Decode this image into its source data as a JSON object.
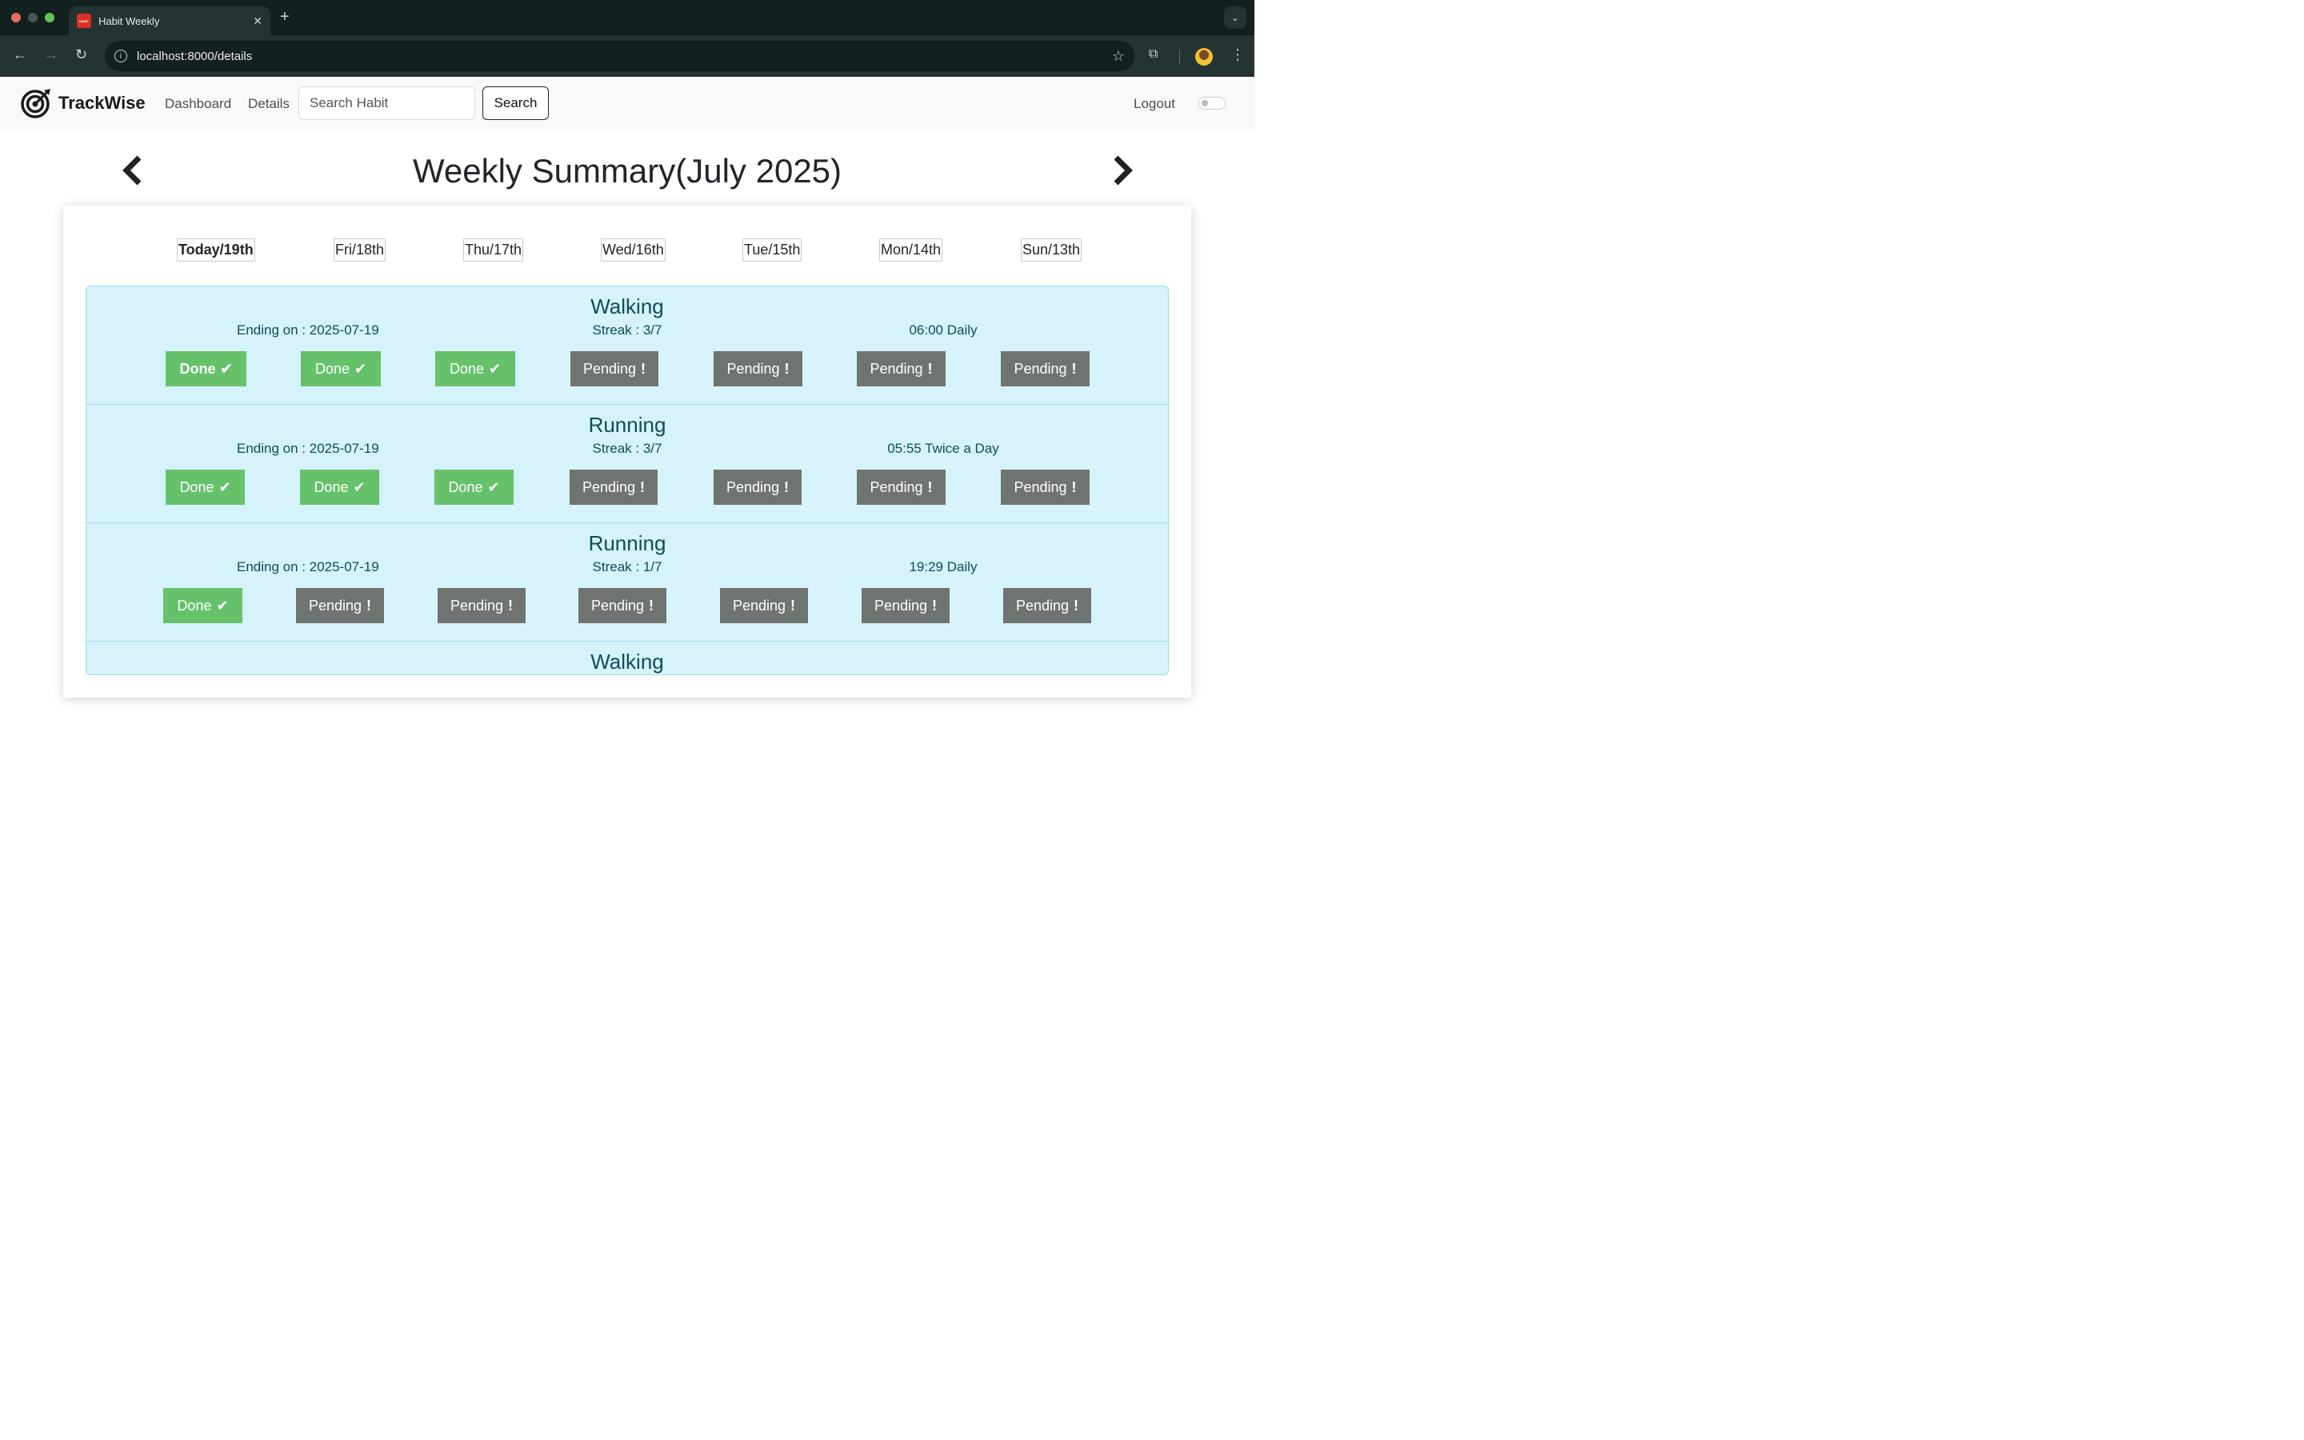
{
  "browser": {
    "tab_title": "Habit Weekly",
    "favicon_text": "HABIT",
    "url": "localhost:8000/details",
    "traffic_colors": [
      "#ed6a5e",
      "#5f6b6a",
      "#61c554"
    ]
  },
  "navbar": {
    "brand": "TrackWise",
    "links": [
      "Dashboard",
      "Details"
    ],
    "search_placeholder": "Search Habit",
    "search_label": "Search",
    "logout_label": "Logout"
  },
  "page": {
    "title": "Weekly Summary(July 2025)"
  },
  "days": [
    "Today/19th",
    "Fri/18th",
    "Thu/17th",
    "Wed/16th",
    "Tue/15th",
    "Mon/14th",
    "Sun/13th"
  ],
  "status_labels": {
    "done": "Done",
    "pending": "Pending"
  },
  "habits": [
    {
      "name": "Walking",
      "ending": "Ending on : 2025-07-19",
      "streak": "Streak : 3/7",
      "schedule": "06:00 Daily",
      "statuses": [
        "done",
        "done",
        "done",
        "pending",
        "pending",
        "pending",
        "pending"
      ]
    },
    {
      "name": "Running",
      "ending": "Ending on : 2025-07-19",
      "streak": "Streak : 3/7",
      "schedule": "05:55 Twice a Day",
      "statuses": [
        "done",
        "done",
        "done",
        "pending",
        "pending",
        "pending",
        "pending"
      ]
    },
    {
      "name": "Running",
      "ending": "Ending on : 2025-07-19",
      "streak": "Streak : 1/7",
      "schedule": "19:29 Daily",
      "statuses": [
        "done",
        "pending",
        "pending",
        "pending",
        "pending",
        "pending",
        "pending"
      ]
    },
    {
      "name": "Walking"
    }
  ],
  "colors": {
    "done": "#65c26b",
    "pending": "#707470",
    "row_bg": "#d6f2fa",
    "habit_text": "#0e4d5c"
  }
}
